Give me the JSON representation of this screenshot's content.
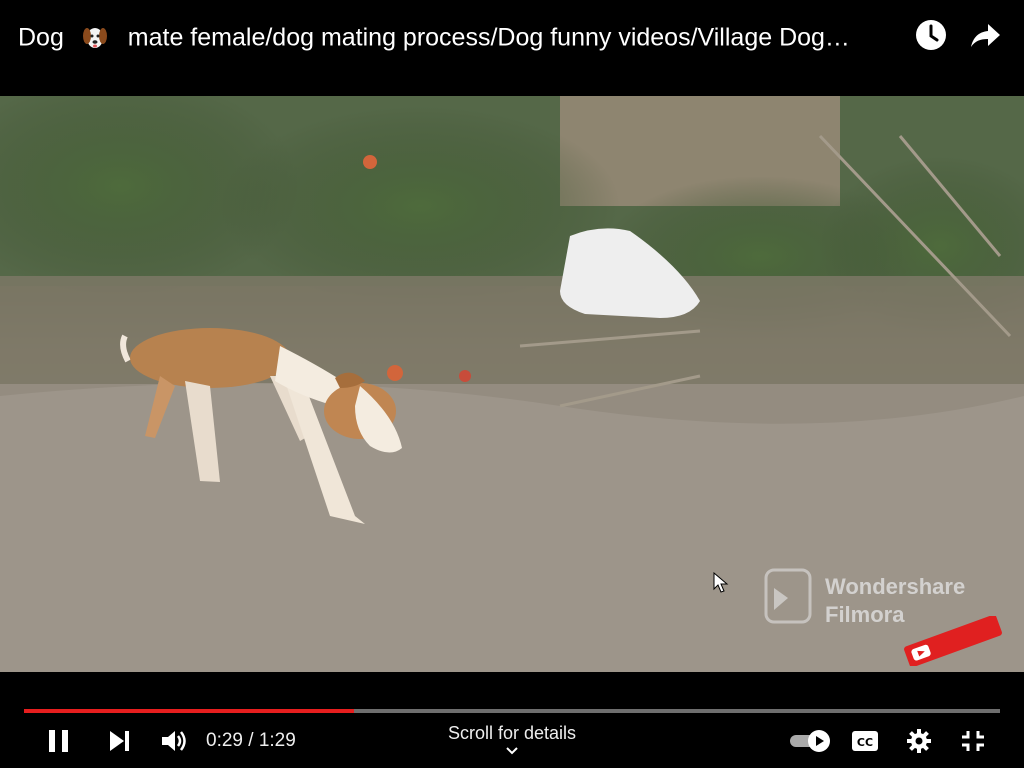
{
  "header": {
    "title_prefix": "Dog",
    "title_rest": "mate female/dog mating process/Dog funny videos/Village Dog…",
    "watch_later_icon": "clock-icon",
    "share_icon": "share-arrow-icon"
  },
  "video": {
    "watermark_brand": "Wondershare",
    "watermark_product": "Filmora",
    "scene": "dog-walking-on-dirt-path"
  },
  "player": {
    "progress_fraction": 0.3378,
    "time_display": "0:29 / 1:29",
    "scroll_hint": "Scroll for details",
    "accent_color": "#e61e1e",
    "autoplay_on": true
  }
}
